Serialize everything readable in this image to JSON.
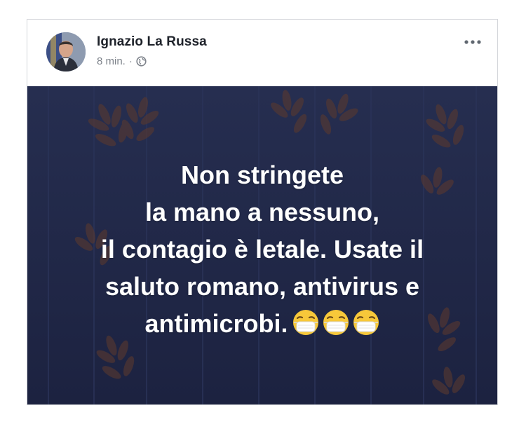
{
  "post": {
    "author": "Ignazio La Russa",
    "time": "8 min.",
    "separator": "·",
    "privacy_icon": "globe-icon",
    "more_icon": "more-dots-icon",
    "more_label": "•••"
  },
  "image": {
    "background_color": "#222a48",
    "motif_color": "#5a3a30",
    "text_lines": [
      "Non stringete",
      "la mano a nessuno,",
      "il contagio è letale. Usate il",
      "saluto romano, antivirus e",
      "antimicrobi."
    ],
    "emoji_icon": "face-with-medical-mask-icon",
    "emoji_count": 3
  }
}
